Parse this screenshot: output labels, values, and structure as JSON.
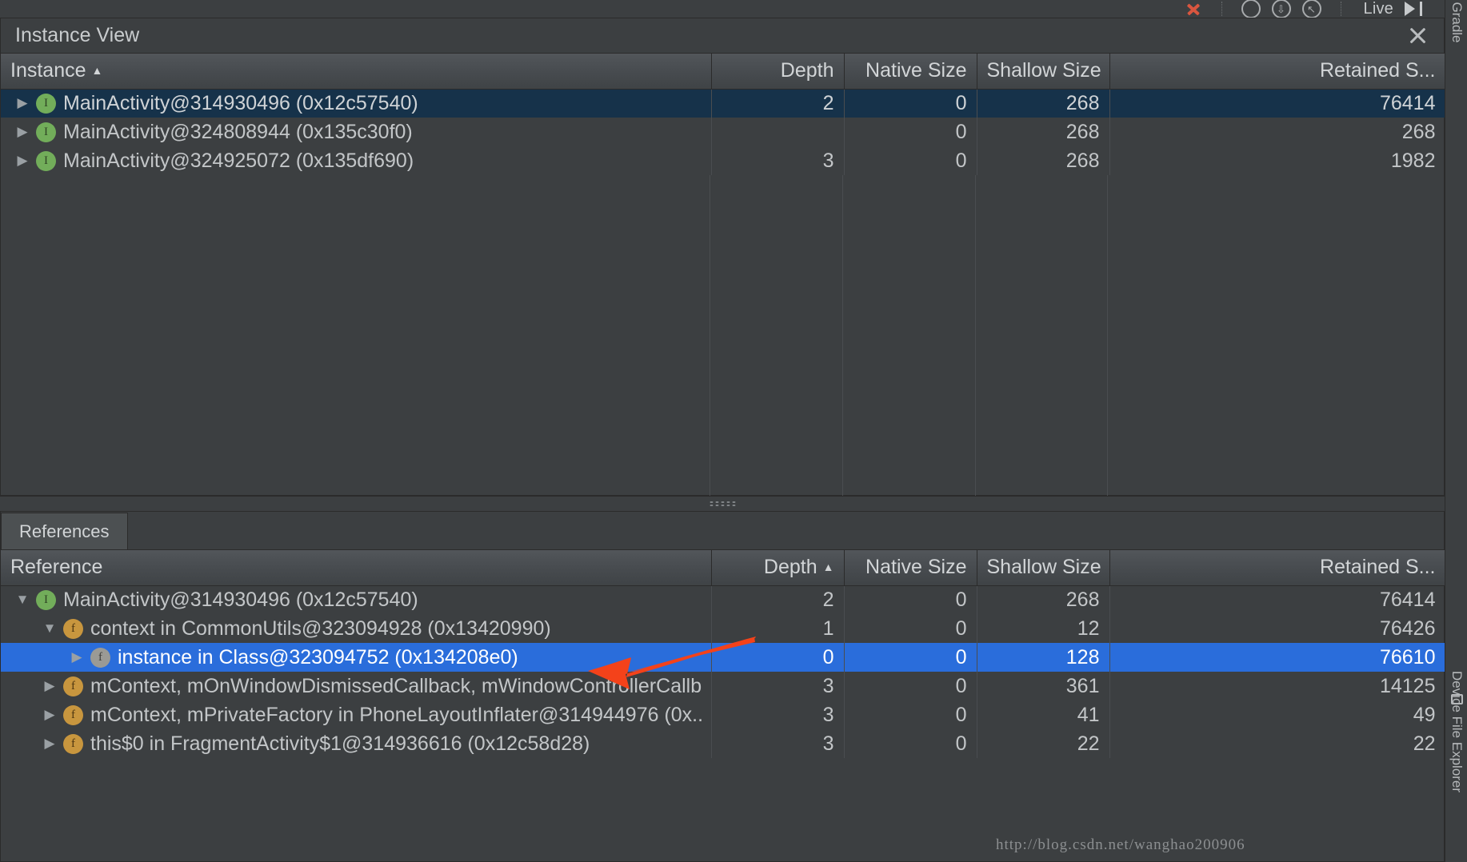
{
  "toolbar": {
    "stop_icon": "close-x-icon",
    "circle_icons": [
      "circle-empty-icon",
      "circle-arrow-down-icon",
      "circle-arrow-up-left-icon"
    ],
    "live_label": "Live",
    "play_end_icon": "play-to-end-icon"
  },
  "instance_view": {
    "title": "Instance View",
    "close_icon": "close-icon",
    "columns": [
      {
        "label": "Instance",
        "align": "left",
        "sort": "asc"
      },
      {
        "label": "Depth",
        "align": "right",
        "sort": ""
      },
      {
        "label": "Native Size",
        "align": "right",
        "sort": ""
      },
      {
        "label": "Shallow Size",
        "align": "right",
        "sort": ""
      },
      {
        "label": "Retained S...",
        "align": "right",
        "sort": ""
      }
    ],
    "rows": [
      {
        "twisty": "collapsed",
        "badge": "instance",
        "badge_letter": "I",
        "name": "MainActivity@314930496 (0x12c57540)",
        "depth": "2",
        "native_size": "0",
        "shallow_size": "268",
        "retained_size": "76414",
        "selected": true,
        "indent": 0
      },
      {
        "twisty": "collapsed",
        "badge": "instance",
        "badge_letter": "I",
        "name": "MainActivity@324808944 (0x135c30f0)",
        "depth": "",
        "native_size": "0",
        "shallow_size": "268",
        "retained_size": "268",
        "selected": false,
        "indent": 0
      },
      {
        "twisty": "collapsed",
        "badge": "instance",
        "badge_letter": "I",
        "name": "MainActivity@324925072 (0x135df690)",
        "depth": "3",
        "native_size": "0",
        "shallow_size": "268",
        "retained_size": "1982",
        "selected": false,
        "indent": 0
      }
    ]
  },
  "references": {
    "tab_label": "References",
    "columns": [
      {
        "label": "Reference",
        "align": "left",
        "sort": ""
      },
      {
        "label": "Depth",
        "align": "right",
        "sort": "asc"
      },
      {
        "label": "Native Size",
        "align": "right",
        "sort": ""
      },
      {
        "label": "Shallow Size",
        "align": "right",
        "sort": ""
      },
      {
        "label": "Retained S...",
        "align": "right",
        "sort": ""
      }
    ],
    "rows": [
      {
        "twisty": "expanded",
        "badge": "instance",
        "badge_letter": "I",
        "name": "MainActivity@314930496 (0x12c57540)",
        "depth": "2",
        "native_size": "0",
        "shallow_size": "268",
        "retained_size": "76414",
        "selected": false,
        "indent": 0
      },
      {
        "twisty": "expanded",
        "badge": "field",
        "badge_letter": "f",
        "name": "context in CommonUtils@323094928 (0x13420990)",
        "depth": "1",
        "native_size": "0",
        "shallow_size": "12",
        "retained_size": "76426",
        "selected": false,
        "indent": 1
      },
      {
        "twisty": "collapsed",
        "badge": "field-gray",
        "badge_letter": "f",
        "name": "instance in Class@323094752 (0x134208e0)",
        "depth": "0",
        "native_size": "0",
        "shallow_size": "128",
        "retained_size": "76610",
        "selected": true,
        "indent": 2
      },
      {
        "twisty": "collapsed",
        "badge": "field",
        "badge_letter": "f",
        "name": "mContext, mOnWindowDismissedCallback, mWindowControllerCallback",
        "depth": "3",
        "native_size": "0",
        "shallow_size": "361",
        "retained_size": "14125",
        "selected": false,
        "indent": 1
      },
      {
        "twisty": "collapsed",
        "badge": "field",
        "badge_letter": "f",
        "name": "mContext, mPrivateFactory in PhoneLayoutInflater@314944976 (0x...)",
        "depth": "3",
        "native_size": "0",
        "shallow_size": "41",
        "retained_size": "49",
        "selected": false,
        "indent": 1
      },
      {
        "twisty": "collapsed",
        "badge": "field",
        "badge_letter": "f",
        "name": "this$0 in FragmentActivity$1@314936616 (0x12c58d28)",
        "depth": "3",
        "native_size": "0",
        "shallow_size": "22",
        "retained_size": "22",
        "selected": false,
        "indent": 1
      }
    ]
  },
  "annotation": {
    "arrow": "red-arrow-pointing-left"
  },
  "watermark": "http://blog.csdn.net/wanghao200906",
  "right_rail": {
    "top_label": "Gradle",
    "bottom_label": "Device File Explorer",
    "bottom_icon": "device-file-explorer-icon"
  },
  "colors": {
    "background": "#3c3f41",
    "selection_dark": "#16324a",
    "selection_blue": "#2a6ddb",
    "accent_red": "#f4421a",
    "instance_badge": "#72ad5a",
    "field_badge": "#c8963e"
  }
}
